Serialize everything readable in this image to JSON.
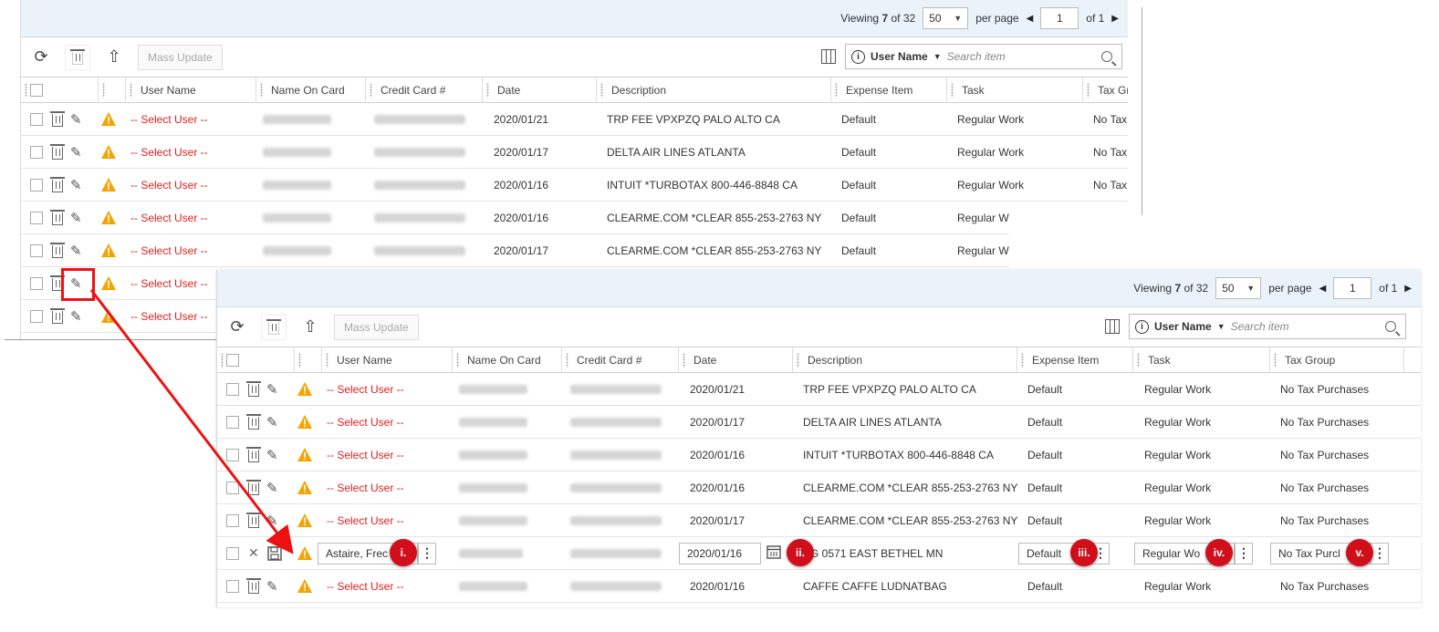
{
  "pagination": {
    "viewing_label": "Viewing",
    "viewing_count": "7",
    "of_label": "of",
    "total": "32",
    "per_page_value": "50",
    "per_page_label": "per page",
    "page": "1",
    "of_pages": "of 1"
  },
  "toolbar": {
    "mass_update": "Mass Update",
    "search_field": "User Name",
    "search_placeholder": "Search item"
  },
  "columns": [
    "User Name",
    "Name On Card",
    "Credit Card #",
    "Date",
    "Description",
    "Expense Item",
    "Task",
    "Tax Gr",
    "Tax Group"
  ],
  "rows": [
    {
      "user": "-- Select User --",
      "date": "2020/01/21",
      "desc": "TRP FEE VPXPZQ PALO ALTO CA",
      "item": "Default",
      "task": "Regular Work",
      "tax": "No Tax Purchases"
    },
    {
      "user": "-- Select User --",
      "date": "2020/01/17",
      "desc": "DELTA AIR LINES ATLANTA",
      "item": "Default",
      "task": "Regular Work",
      "tax": "No Tax Purchases"
    },
    {
      "user": "-- Select User --",
      "date": "2020/01/16",
      "desc": "INTUIT *TURBOTAX 800-446-8848 CA",
      "item": "Default",
      "task": "Regular Work",
      "tax": "No Tax Purchases"
    },
    {
      "user": "-- Select User --",
      "date": "2020/01/16",
      "desc": "CLEARME.COM *CLEAR 855-253-2763 NY",
      "item": "Default",
      "task": "Regular Work",
      "tax": "No Tax Purchases"
    },
    {
      "user": "-- Select User --",
      "date": "2020/01/17",
      "desc": "CLEARME.COM *CLEAR 855-253-2763 NY",
      "item": "Default",
      "task": "Regular Work",
      "tax": "No Tax Purchases"
    }
  ],
  "back_partial": {
    "tax": "No Tax",
    "task_cut": "Regular W"
  },
  "edit_row": {
    "user": "Astaire, Frec",
    "date": "2020/01/16",
    "desc": "G 0571 EAST BETHEL MN",
    "item": "Default",
    "task": "Regular Wo",
    "tax": "No Tax Purcl"
  },
  "last_row": {
    "user": "-- Select User --",
    "date": "2020/01/16",
    "desc": "CAFFE CAFFE LUDNATBAG",
    "item": "Default",
    "task": "Regular Work",
    "tax": "No Tax Purchases"
  },
  "badges": [
    "i.",
    "ii.",
    "iii.",
    "iv.",
    "v."
  ],
  "colors": {
    "accent_red": "#d10f1b",
    "link_red": "#e02020",
    "header_bg": "#eaf3fa",
    "warn": "#f5a300"
  }
}
